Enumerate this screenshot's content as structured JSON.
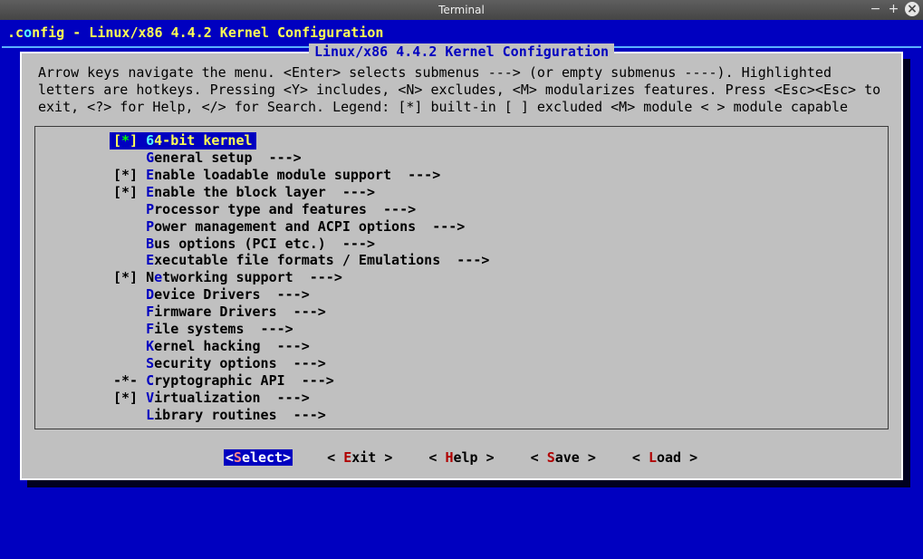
{
  "window": {
    "title": "Terminal"
  },
  "config_header": {
    "prefix": ".c",
    "hotkey": "o",
    "rest": "nfig - Linux/x86 4.4.2 Kernel Configuration"
  },
  "dialog": {
    "caption": "Linux/x86 4.4.2 Kernel Configuration",
    "help": "Arrow keys navigate the menu.  <Enter> selects submenus ---> (or empty submenus ----).  Highlighted letters are hotkeys.  Pressing <Y> includes, <N> excludes, <M> modularizes features.  Press <Esc><Esc> to exit, <?> for Help, </> for Search.  Legend: [*] built-in  [ ] excluded  <M> module  < > module capable"
  },
  "menu": [
    {
      "prefix": "[",
      "mark": "*",
      "post": "] ",
      "hot": "6",
      "text": "4-bit kernel",
      "arrow": "",
      "selected": true
    },
    {
      "prefix": "    ",
      "mark": "",
      "post": "",
      "hot": "G",
      "text": "eneral setup  --->",
      "arrow": ""
    },
    {
      "prefix": "[*] ",
      "mark": "",
      "post": "",
      "hot": "E",
      "text": "nable loadable module support  --->",
      "arrow": ""
    },
    {
      "prefix": "[*] ",
      "mark": "",
      "post": "",
      "hot": "E",
      "text": "nable the block layer  --->",
      "arrow": ""
    },
    {
      "prefix": "    ",
      "mark": "",
      "post": "",
      "hot": "P",
      "text": "rocessor type and features  --->",
      "arrow": ""
    },
    {
      "prefix": "    ",
      "mark": "",
      "post": "",
      "hot": "P",
      "text": "ower management and ACPI options  --->",
      "arrow": ""
    },
    {
      "prefix": "    ",
      "mark": "",
      "post": "",
      "hot": "B",
      "text": "us options (PCI etc.)  --->",
      "arrow": ""
    },
    {
      "prefix": "    ",
      "mark": "",
      "post": "",
      "hot": "E",
      "text": "xecutable file formats / Emulations  --->",
      "arrow": ""
    },
    {
      "prefix": "[*] N",
      "mark": "",
      "post": "",
      "hot": "e",
      "text": "tworking support  --->",
      "arrow": ""
    },
    {
      "prefix": "    ",
      "mark": "",
      "post": "",
      "hot": "D",
      "text": "evice Drivers  --->",
      "arrow": ""
    },
    {
      "prefix": "    ",
      "mark": "",
      "post": "",
      "hot": "F",
      "text": "irmware Drivers  --->",
      "arrow": ""
    },
    {
      "prefix": "    ",
      "mark": "",
      "post": "",
      "hot": "F",
      "text": "ile systems  --->",
      "arrow": ""
    },
    {
      "prefix": "    ",
      "mark": "",
      "post": "",
      "hot": "K",
      "text": "ernel hacking  --->",
      "arrow": ""
    },
    {
      "prefix": "    ",
      "mark": "",
      "post": "",
      "hot": "S",
      "text": "ecurity options  --->",
      "arrow": ""
    },
    {
      "prefix": "-*- ",
      "mark": "",
      "post": "",
      "hot": "C",
      "text": "ryptographic API  --->",
      "arrow": ""
    },
    {
      "prefix": "[*] ",
      "mark": "",
      "post": "",
      "hot": "V",
      "text": "irtualization  --->",
      "arrow": ""
    },
    {
      "prefix": "    ",
      "mark": "",
      "post": "",
      "hot": "L",
      "text": "ibrary routines  --->",
      "arrow": ""
    }
  ],
  "buttons": [
    {
      "open": "<",
      "hot": "S",
      "rest": "elect>",
      "close": "",
      "selected": true
    },
    {
      "open": "< ",
      "hot": "E",
      "rest": "xit >",
      "close": ""
    },
    {
      "open": "< ",
      "hot": "H",
      "rest": "elp >",
      "close": ""
    },
    {
      "open": "< ",
      "hot": "S",
      "rest": "ave >",
      "close": ""
    },
    {
      "open": "< ",
      "hot": "L",
      "rest": "oad >",
      "close": ""
    }
  ]
}
